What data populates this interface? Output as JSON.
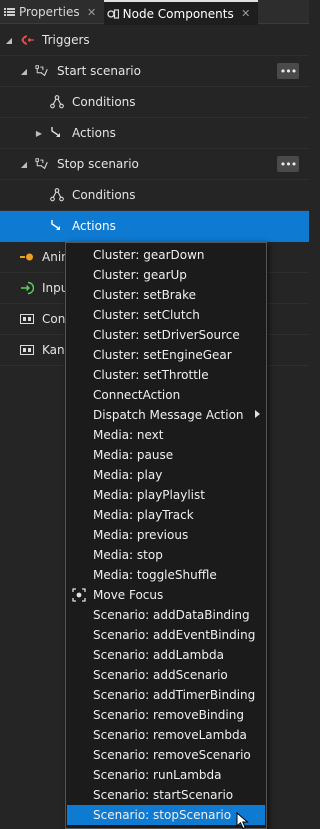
{
  "tabs": [
    {
      "label": "Properties",
      "active": false,
      "icon": "list-icon"
    },
    {
      "label": "Node Components",
      "active": true,
      "icon": "node-components-icon"
    }
  ],
  "tree": {
    "triggers": "Triggers",
    "start_scenario": "Start scenario",
    "start_conditions": "Conditions",
    "start_actions": "Actions",
    "stop_scenario": "Stop scenario",
    "stop_conditions": "Conditions",
    "stop_actions": "Actions",
    "animations": "Anim",
    "inputs": "Inpu",
    "connections": "Conn",
    "kanzi": "Kanz",
    "more_label": "•••"
  },
  "menu": {
    "items": [
      "Cluster: gearDown",
      "Cluster: gearUp",
      "Cluster: setBrake",
      "Cluster: setClutch",
      "Cluster: setDriverSource",
      "Cluster: setEngineGear",
      "Cluster: setThrottle",
      "ConnectAction",
      "Dispatch Message Action",
      "Media: next",
      "Media: pause",
      "Media: play",
      "Media: playPlaylist",
      "Media: playTrack",
      "Media: previous",
      "Media: stop",
      "Media: toggleShuffle",
      "Move Focus",
      "Scenario: addDataBinding",
      "Scenario: addEventBinding",
      "Scenario: addLambda",
      "Scenario: addScenario",
      "Scenario: addTimerBinding",
      "Scenario: removeBinding",
      "Scenario: removeLambda",
      "Scenario: removeScenario",
      "Scenario: runLambda",
      "Scenario: startScenario",
      "Scenario: stopScenario"
    ],
    "highlighted_index": 28,
    "submenu_index": 8,
    "icon_index": 17
  },
  "colors": {
    "accent": "#0e7ad2",
    "panel": "#252526",
    "menu_bg": "#1b1b1b",
    "trigger_icon": "#e0504a",
    "animation_icon": "#f0a020",
    "input_icon": "#5fd05f"
  }
}
